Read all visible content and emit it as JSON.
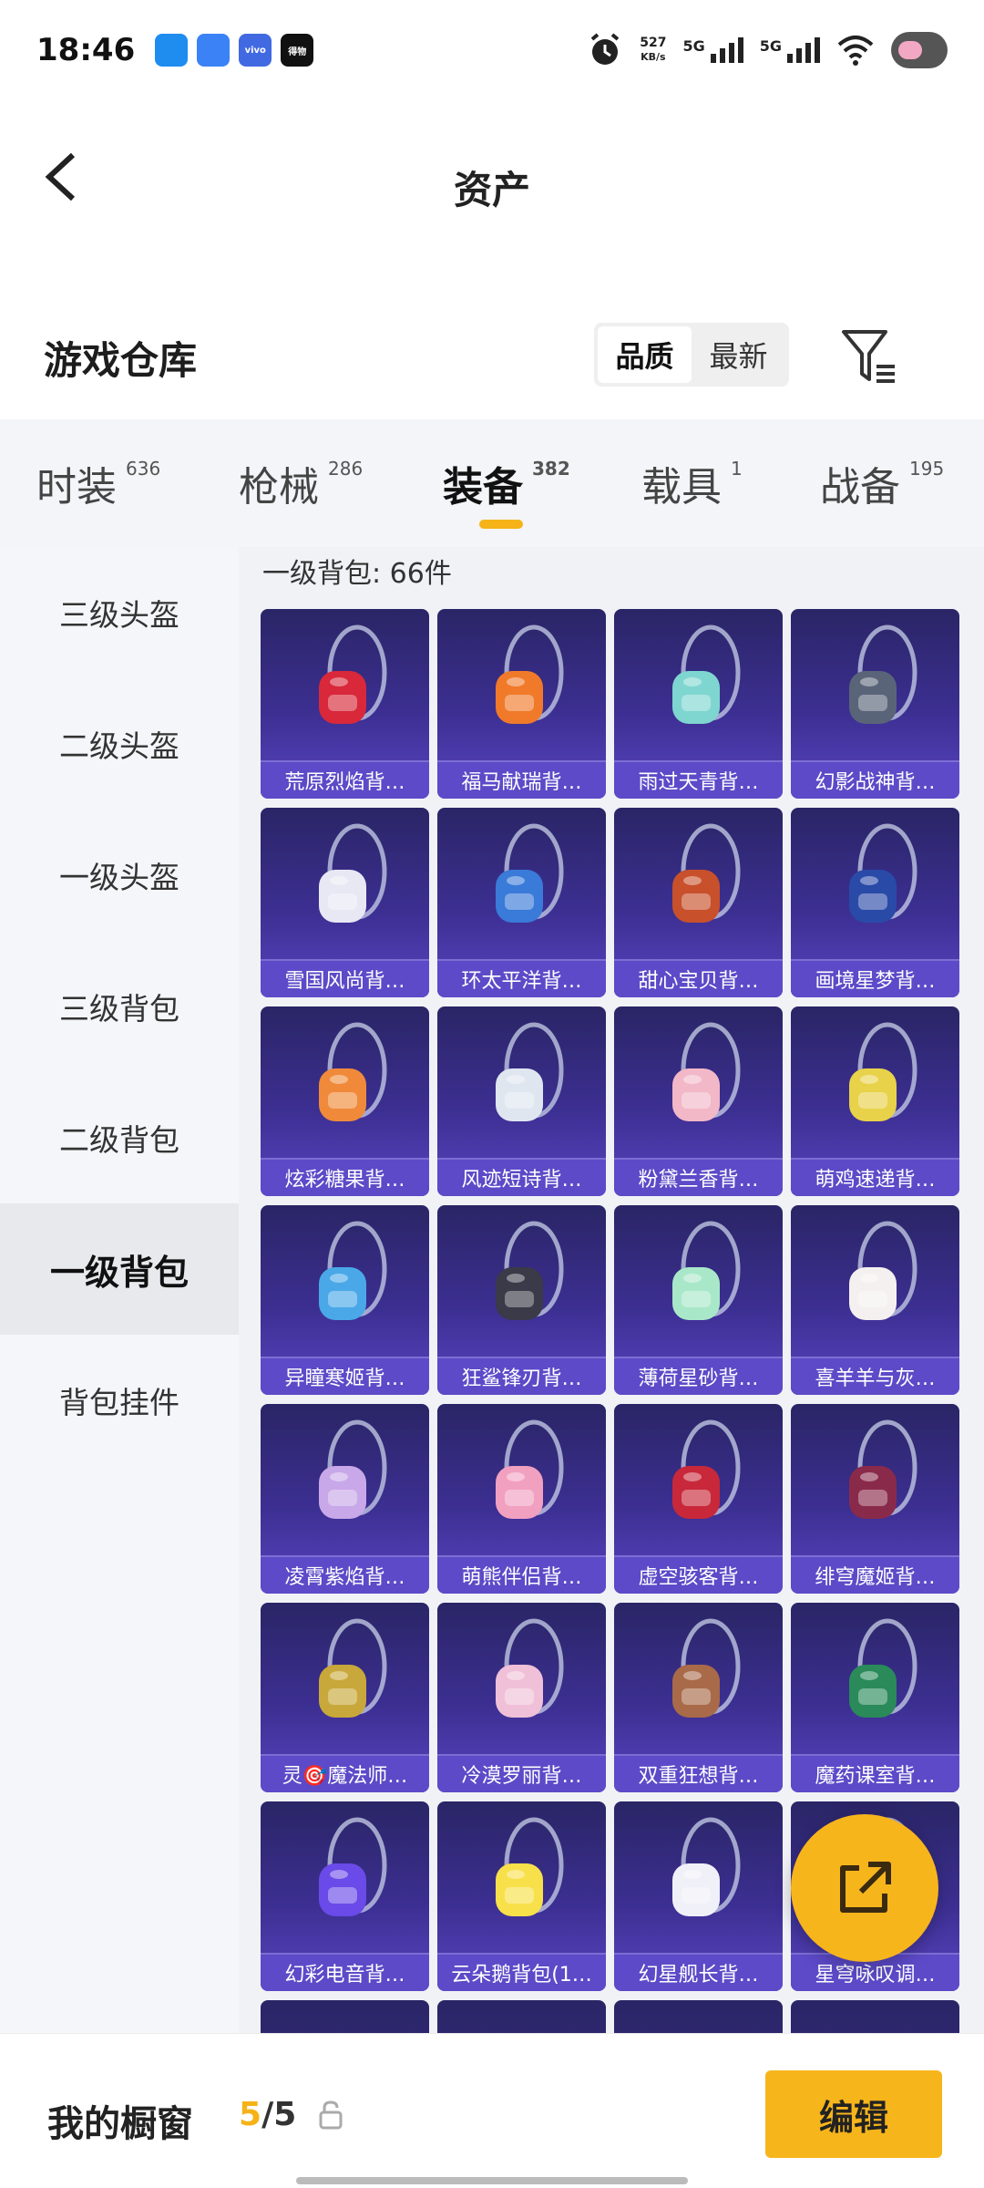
{
  "status_bar": {
    "time": "18:46",
    "apps": [
      {
        "name": "cloud-app-icon",
        "color": "#1f8cf0",
        "text": ""
      },
      {
        "name": "browser-app-icon",
        "color": "#3b82f6",
        "text": ""
      },
      {
        "name": "vivo-app-icon",
        "color": "#4169e1",
        "text": "vivo"
      },
      {
        "name": "game-app-icon",
        "color": "#111111",
        "text": "得物"
      }
    ],
    "net_speed_value": "527",
    "net_speed_unit": "KB/s",
    "sim1": "5G",
    "sim2": "5G"
  },
  "header": {
    "title": "资产"
  },
  "section": {
    "title": "游戏仓库",
    "sort_options": [
      "品质",
      "最新"
    ],
    "active_sort": "品质"
  },
  "tabs": [
    {
      "label": "时装",
      "count": "636"
    },
    {
      "label": "枪械",
      "count": "286"
    },
    {
      "label": "装备",
      "count": "382"
    },
    {
      "label": "载具",
      "count": "1"
    },
    {
      "label": "战备",
      "count": "195"
    }
  ],
  "active_tab": "装备",
  "categories": [
    "三级头盔",
    "二级头盔",
    "一级头盔",
    "三级背包",
    "二级背包",
    "一级背包",
    "背包挂件"
  ],
  "active_category": "一级背包",
  "grid": {
    "header": "一级背包: 66件",
    "items": [
      {
        "label": "荒原烈焰背…",
        "color": "#d8283a"
      },
      {
        "label": "福马献瑞背…",
        "color": "#f07a2a"
      },
      {
        "label": "雨过天青背…",
        "color": "#7fd6d0"
      },
      {
        "label": "幻影战神背…",
        "color": "#5a6478"
      },
      {
        "label": "雪国风尚背…",
        "color": "#e8e8f4"
      },
      {
        "label": "环太平洋背…",
        "color": "#3a7ad8"
      },
      {
        "label": "甜心宝贝背…",
        "color": "#c8502a"
      },
      {
        "label": "画境星梦背…",
        "color": "#2a4aa8"
      },
      {
        "label": "炫彩糖果背…",
        "color": "#f08a3a"
      },
      {
        "label": "风迹短诗背…",
        "color": "#dfe6f0"
      },
      {
        "label": "粉黛兰香背…",
        "color": "#f2b8c8"
      },
      {
        "label": "萌鸡速递背…",
        "color": "#e8d24a"
      },
      {
        "label": "异瞳寒姬背…",
        "color": "#4aa8e8"
      },
      {
        "label": "狂鲨锋刃背…",
        "color": "#3a3a48"
      },
      {
        "label": "薄荷星砂背…",
        "color": "#a8e8c8"
      },
      {
        "label": "喜羊羊与灰…",
        "color": "#f4f0f0"
      },
      {
        "label": "凌霄紫焰背…",
        "color": "#c8a8e8"
      },
      {
        "label": "萌熊伴侣背…",
        "color": "#f2a0c0"
      },
      {
        "label": "虚空骇客背…",
        "color": "#c8283a"
      },
      {
        "label": "绯穹魔姬背…",
        "color": "#8a2a4a"
      },
      {
        "label": "灵🎯魔法师…",
        "color": "#c8a83a"
      },
      {
        "label": "冷漠罗丽背…",
        "color": "#f0c0d8"
      },
      {
        "label": "双重狂想背…",
        "color": "#a86a48"
      },
      {
        "label": "魔药课室背…",
        "color": "#2a8a5a"
      },
      {
        "label": "幻彩电音背…",
        "color": "#6a4ae8"
      },
      {
        "label": "云朵鹅背包(1…",
        "color": "#f8e04a"
      },
      {
        "label": "幻星舰长背…",
        "color": "#f0f0f8"
      },
      {
        "label": "星穹咏叹调…",
        "color": "#8a6ae8"
      }
    ]
  },
  "bottom_bar": {
    "window_label": "我的橱窗",
    "current": "5",
    "total": "/5",
    "edit_label": "编辑"
  }
}
